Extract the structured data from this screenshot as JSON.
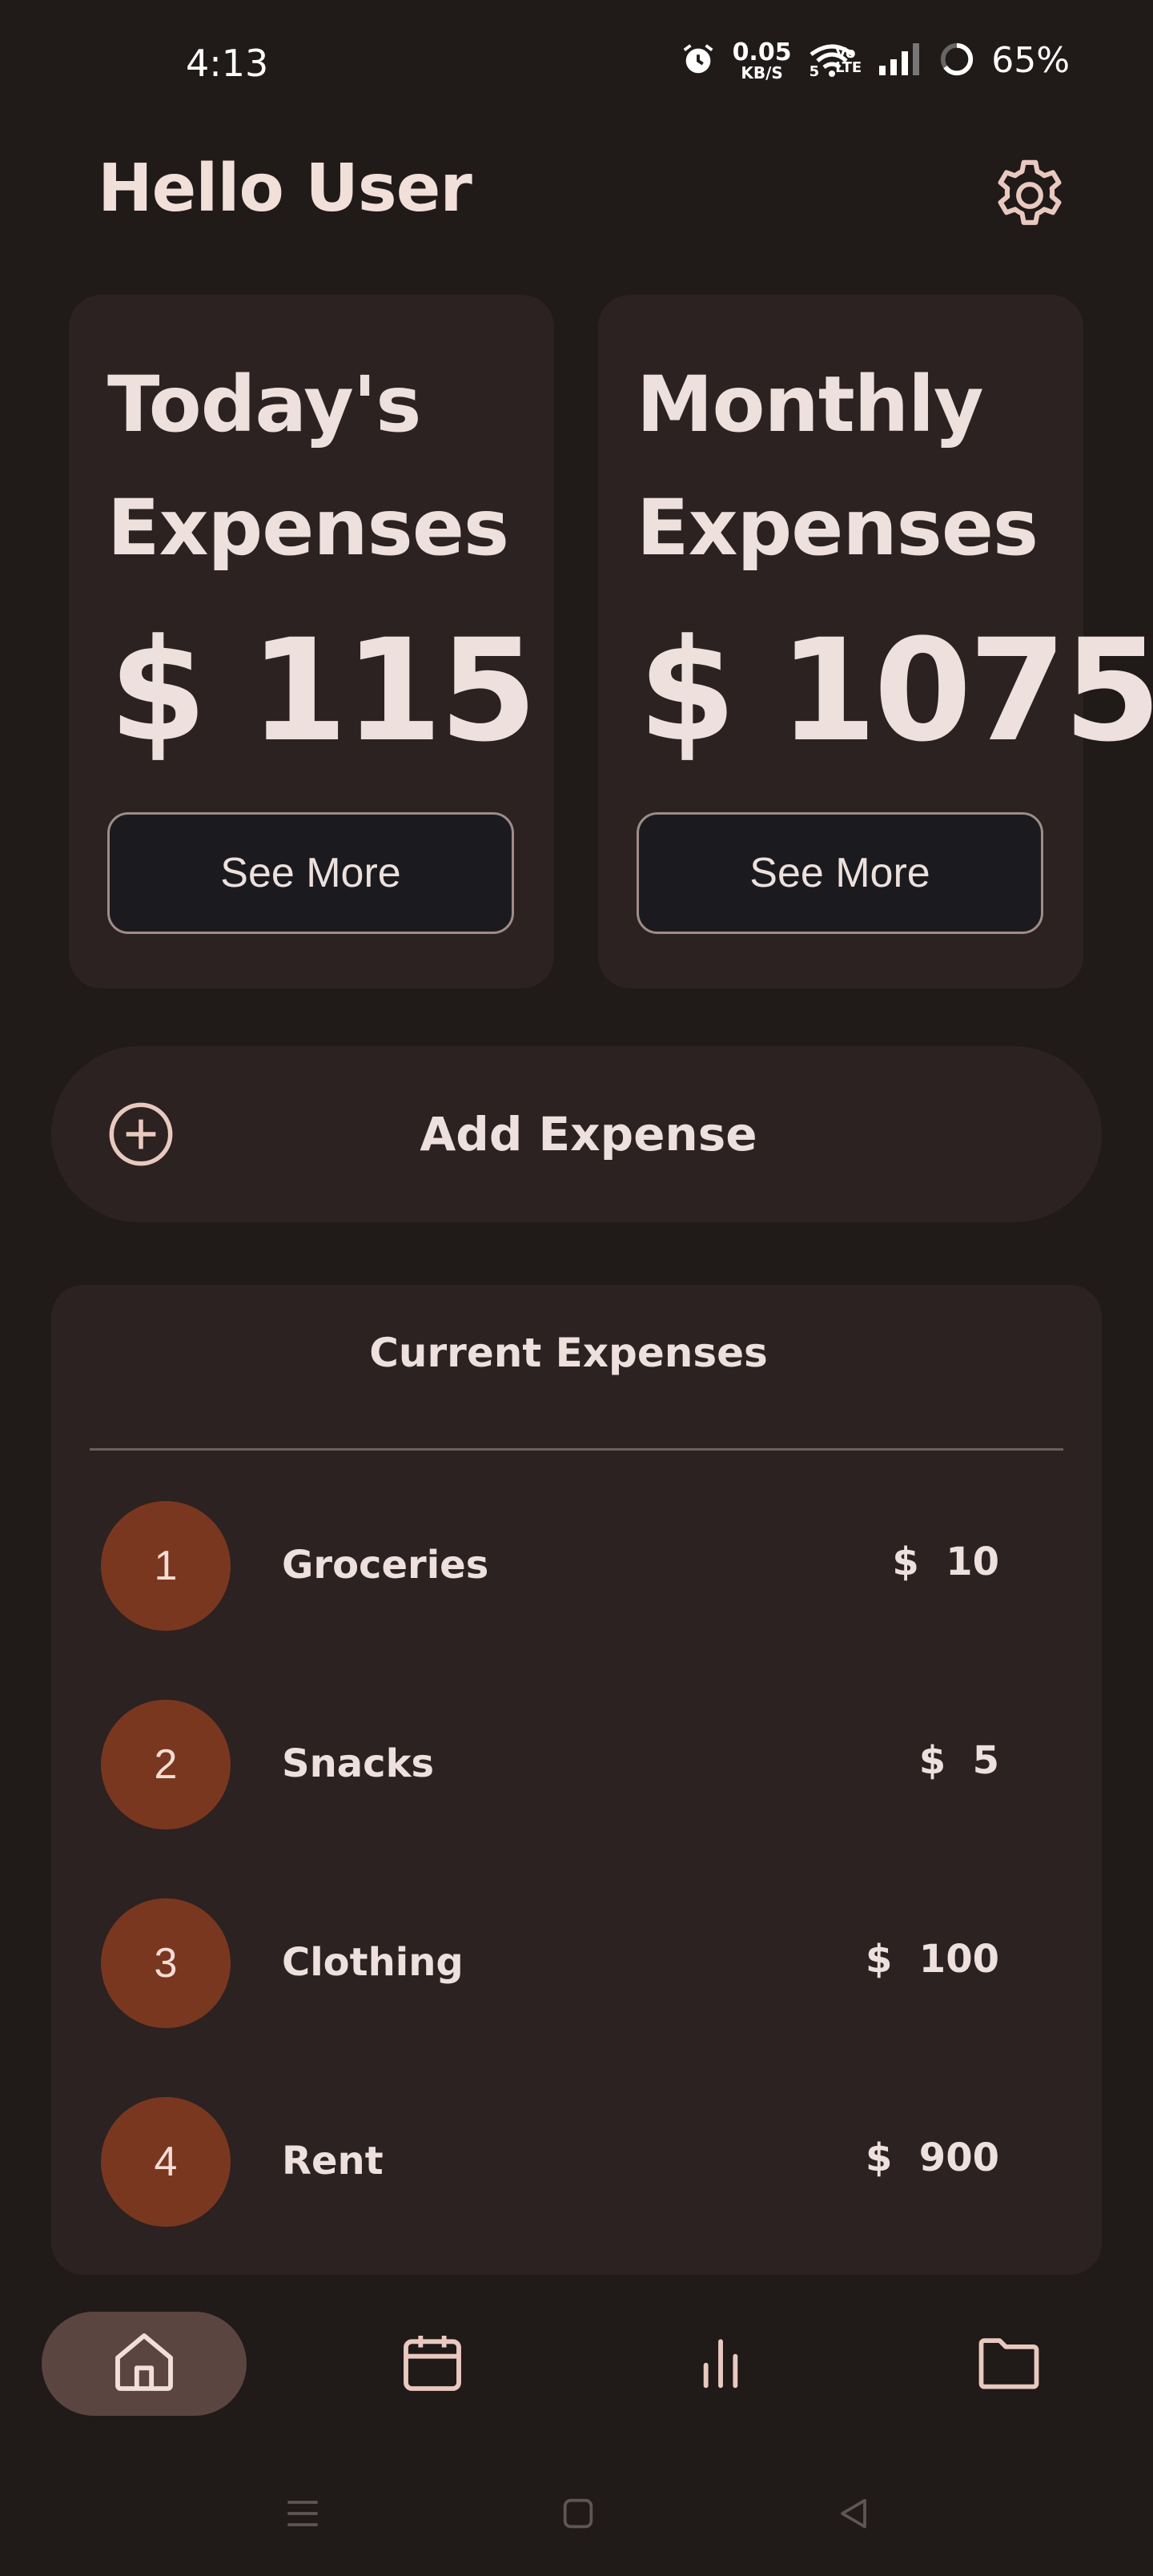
{
  "status_bar": {
    "time": "4:13",
    "net_speed_value": "0.05",
    "net_speed_unit": "KB/S",
    "wifi_badge": "5",
    "volte_top": "Vo",
    "volte_bottom": "LTE",
    "battery": "65%"
  },
  "header": {
    "greeting": "Hello User"
  },
  "cards": [
    {
      "title": "Today's Expenses",
      "amount": "$ 115",
      "button_label": "See More"
    },
    {
      "title": "Monthly Expenses",
      "amount": "$ 1075",
      "button_label": "See More"
    }
  ],
  "add_expense": {
    "label": "Add Expense"
  },
  "current_expenses": {
    "title": "Current Expenses",
    "items": [
      {
        "index": "1",
        "name": "Groceries",
        "amount": "$  10"
      },
      {
        "index": "2",
        "name": "Snacks",
        "amount": "$  5"
      },
      {
        "index": "3",
        "name": "Clothing",
        "amount": "$  100"
      },
      {
        "index": "4",
        "name": "Rent",
        "amount": "$  900"
      }
    ]
  },
  "bottom_nav": {
    "active": "home",
    "items": [
      "home-icon",
      "calendar-icon",
      "bar-chart-icon",
      "folder-icon"
    ]
  },
  "colors": {
    "background": "#201a19",
    "surface": "#2b2221",
    "badge": "#7a3720",
    "nav_active": "#5b4541",
    "text": "#ede0dd"
  }
}
